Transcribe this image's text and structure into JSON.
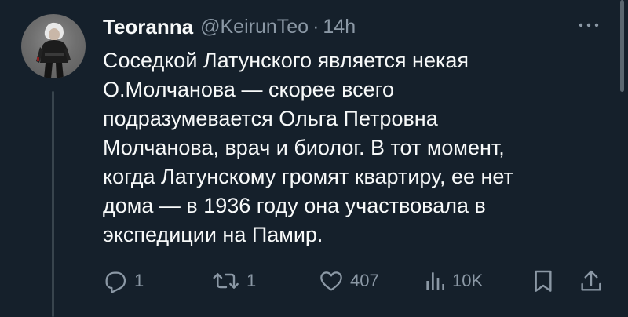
{
  "author": {
    "display_name": "Teoranna",
    "handle": "@KeirunTeo",
    "separator": "·",
    "time": "14h"
  },
  "tweet": {
    "lines": [
      "Соседкой Латунского является некая",
      "О.Молчанова — скорее всего",
      "подразумевается Ольга Петровна",
      "Молчанова, врач и биолог. В тот момент,",
      "когда Латунскому громят квартиру, ее нет",
      "дома — в 1936 году она участвовала в",
      "экспедиции на Памир."
    ]
  },
  "actions": {
    "replies": "1",
    "retweets": "1",
    "likes": "407",
    "views": "10K"
  },
  "icons": {
    "more": "more-icon",
    "reply": "reply-icon",
    "retweet": "retweet-icon",
    "like": "heart-icon",
    "views": "views-icon",
    "bookmark": "bookmark-icon",
    "share": "share-icon"
  },
  "colors": {
    "background": "#15202b",
    "text": "#f7f9f9",
    "secondary": "#8b98a5",
    "thread_line": "#38444d"
  }
}
